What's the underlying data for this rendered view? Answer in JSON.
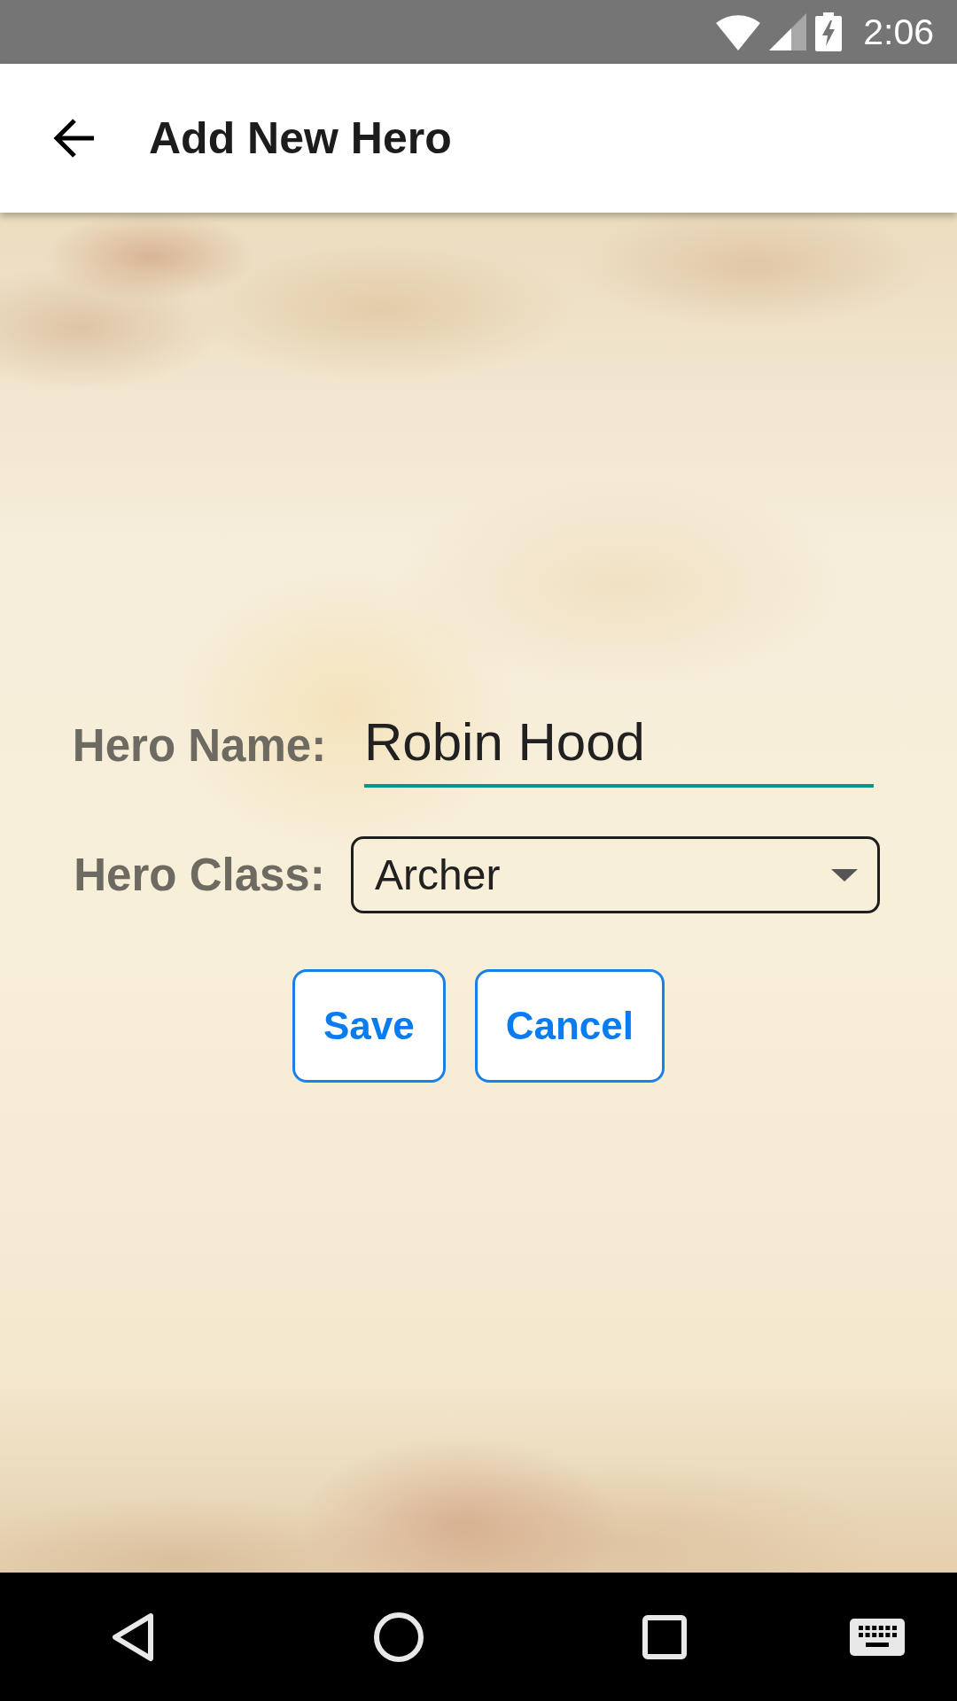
{
  "status_bar": {
    "time": "2:06"
  },
  "app_bar": {
    "title": "Add New Hero"
  },
  "form": {
    "fields": [
      {
        "kind": "text",
        "label": "Hero Name:",
        "value": "Robin Hood",
        "focused": true
      },
      {
        "kind": "dropdown",
        "label": "Hero Class:",
        "value": "Archer",
        "focused": false
      }
    ],
    "buttons": [
      {
        "label": "Save"
      },
      {
        "label": "Cancel"
      }
    ]
  }
}
